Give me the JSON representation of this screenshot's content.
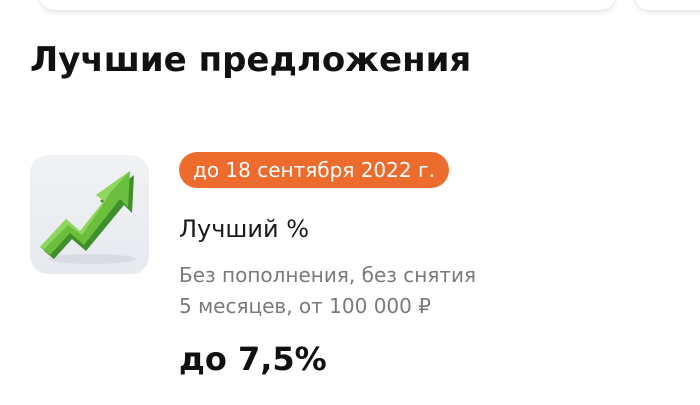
{
  "section": {
    "title": "Лучшие предложения"
  },
  "offer": {
    "badge": "до 18 сентября 2022 г.",
    "name": "Лучший %",
    "description_line1": "Без пополнения, без снятия",
    "description_line2": "5 месяцев, от 100 000 ₽",
    "rate": "до 7,5%",
    "icon": "growth-arrow-icon"
  },
  "colors": {
    "badge_background": "#ec6b2d",
    "arrow_green": "#6cbf3c",
    "secondary_text": "#7a7a7a"
  }
}
